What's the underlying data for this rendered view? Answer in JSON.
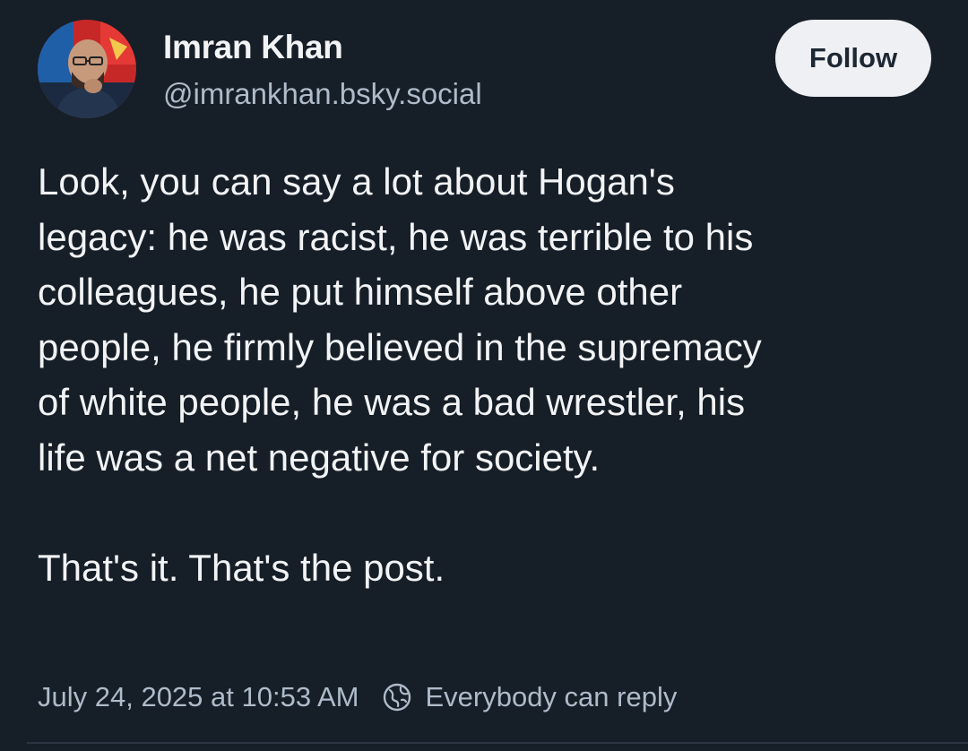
{
  "author": {
    "display_name": "Imran Khan",
    "handle": "@imrankhan.bsky.social"
  },
  "follow_button": {
    "label": "Follow"
  },
  "post": {
    "lines": [
      "Look, you can say a lot about Hogan's",
      "legacy: he was racist, he was terrible to his",
      "colleagues, he put himself above other",
      "people, he firmly believed in the supremacy",
      "of white people, he was a bad wrestler, his",
      "life was a net negative for society."
    ],
    "closing": "That's it. That's the post."
  },
  "footer": {
    "timestamp": "July 24, 2025 at 10:53 AM",
    "reply_setting": "Everybody can reply",
    "reply_icon": "globe-icon"
  },
  "colors": {
    "background": "#161e27",
    "text_primary": "#f1f3f5",
    "text_secondary": "#aebbc9",
    "follow_button_bg": "#eef0f3"
  }
}
